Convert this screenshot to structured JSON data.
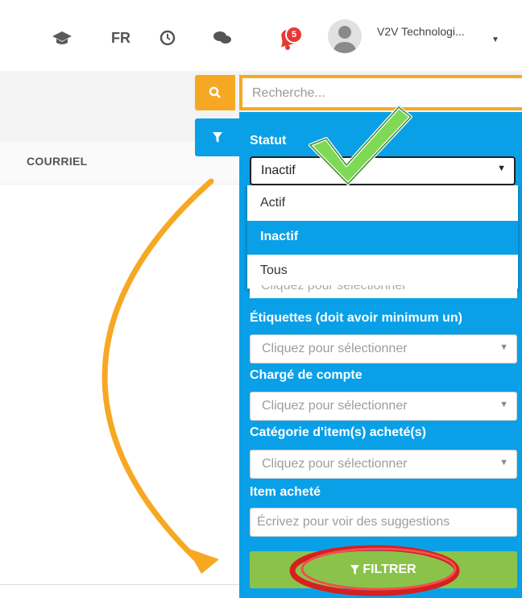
{
  "topbar": {
    "language": "FR",
    "user_name": "V2V Technologi...",
    "notification_count": "5",
    "icons": [
      "graduation-cap-icon",
      "clock-icon",
      "chat-icon",
      "bell-icon",
      "avatar",
      "caret-down-icon"
    ]
  },
  "search": {
    "placeholder": "Recherche..."
  },
  "table": {
    "column_email": "COURRIEL"
  },
  "filters": {
    "statut": {
      "label": "Statut",
      "selected": "Inactif",
      "options": [
        "Actif",
        "Inactif",
        "Tous"
      ]
    },
    "hidden_field": {
      "placeholder": "Cliquez pour sélectionner"
    },
    "etiquettes": {
      "label": "Étiquettes (doit avoir minimum un)",
      "placeholder": "Cliquez pour sélectionner"
    },
    "charge_compte": {
      "label": "Chargé de compte",
      "placeholder": "Cliquez pour sélectionner"
    },
    "categorie": {
      "label": "Catégorie d'item(s) acheté(s)",
      "placeholder": "Cliquez pour sélectionner"
    },
    "item": {
      "label": "Item acheté",
      "placeholder": "Écrivez pour voir des suggestions"
    },
    "submit_label": "FILTRER"
  },
  "colors": {
    "accent_blue": "#0aa0e8",
    "search_orange": "#f7a823",
    "filter_green": "#8bc34a",
    "notification_red": "#e53935",
    "annotation_arrow": "#f7a823",
    "annotation_circle": "#d62020",
    "annotation_check": "#7ed957"
  }
}
